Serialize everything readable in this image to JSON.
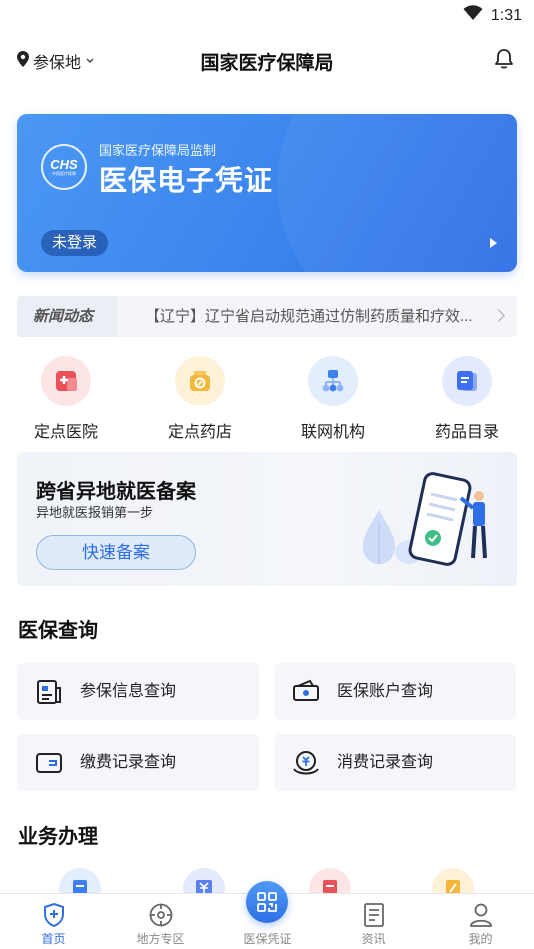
{
  "status_bar": {
    "time": "1:31",
    "icons": [
      "wifi-icon",
      "battery-icon"
    ]
  },
  "header": {
    "location_label": "参保地",
    "title": "国家医疗保障局"
  },
  "card": {
    "logo_text": "CHS",
    "logo_subtext": "中国医疗保障",
    "subtitle": "国家医疗保障局监制",
    "title": "医保电子凭证",
    "login_status": "未登录"
  },
  "news": {
    "label": "新闻动态",
    "text": "【辽宁】辽宁省启动规范通过仿制药质量和疗效..."
  },
  "quick_links": [
    {
      "label": "定点医院",
      "icon": "hospital-icon",
      "color": "#e9505a"
    },
    {
      "label": "定点药店",
      "icon": "pharmacy-icon",
      "color": "#f4b73a"
    },
    {
      "label": "联网机构",
      "icon": "network-icon",
      "color": "#3d7ff0"
    },
    {
      "label": "药品目录",
      "icon": "drug-catalog-icon",
      "color": "#3d6ff0"
    }
  ],
  "banner": {
    "title": "跨省异地就医备案",
    "subtitle": "异地就医报销第一步",
    "button": "快速备案"
  },
  "query_section": {
    "title": "医保查询",
    "items": [
      {
        "label": "参保信息查询",
        "icon": "insurance-info-icon"
      },
      {
        "label": "医保账户查询",
        "icon": "account-icon"
      },
      {
        "label": "缴费记录查询",
        "icon": "wallet-icon"
      },
      {
        "label": "消费记录查询",
        "icon": "consumption-icon"
      }
    ]
  },
  "business_section": {
    "title": "业务办理"
  },
  "tab_bar": {
    "items": [
      {
        "label": "首页",
        "icon": "home-shield-icon",
        "active": true
      },
      {
        "label": "地方专区",
        "icon": "local-area-icon",
        "active": false
      },
      {
        "label": "医保凭证",
        "icon": "qr-code-icon",
        "active": false
      },
      {
        "label": "资讯",
        "icon": "news-icon",
        "active": false
      },
      {
        "label": "我的",
        "icon": "profile-icon",
        "active": false
      }
    ]
  },
  "colors": {
    "accent": "#2f6fe6",
    "card_gradient_start": "#4a98f3",
    "card_gradient_end": "#2f6fe6"
  }
}
